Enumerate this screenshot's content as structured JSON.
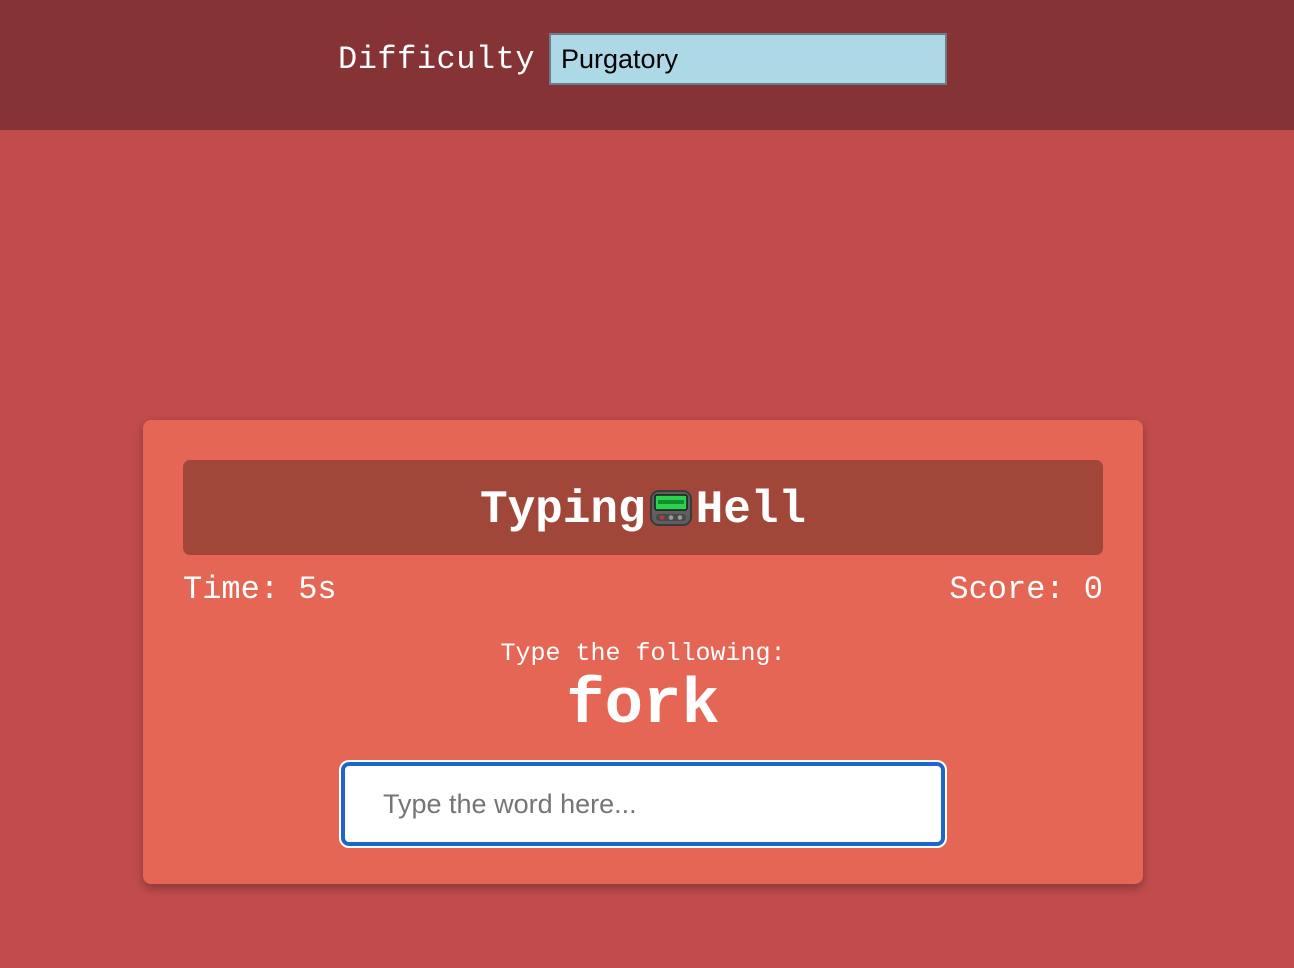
{
  "header": {
    "difficulty_label": "Difficulty",
    "difficulty_selected": "Purgatory"
  },
  "game": {
    "title_left": "Typing",
    "title_icon": "pager-icon",
    "title_right": "Hell",
    "time_text": "Time: 5s",
    "score_text": "Score: 0",
    "prompt": "Type the following:",
    "word": "fork",
    "input_placeholder": "Type the word here...",
    "input_value": ""
  },
  "colors": {
    "page_bg": "#c24c4d",
    "topbar_bg": "#863336",
    "card_bg": "#e56654",
    "title_bg": "#a1473a",
    "select_bg": "#add8e6",
    "input_border": "#1e66c8"
  }
}
